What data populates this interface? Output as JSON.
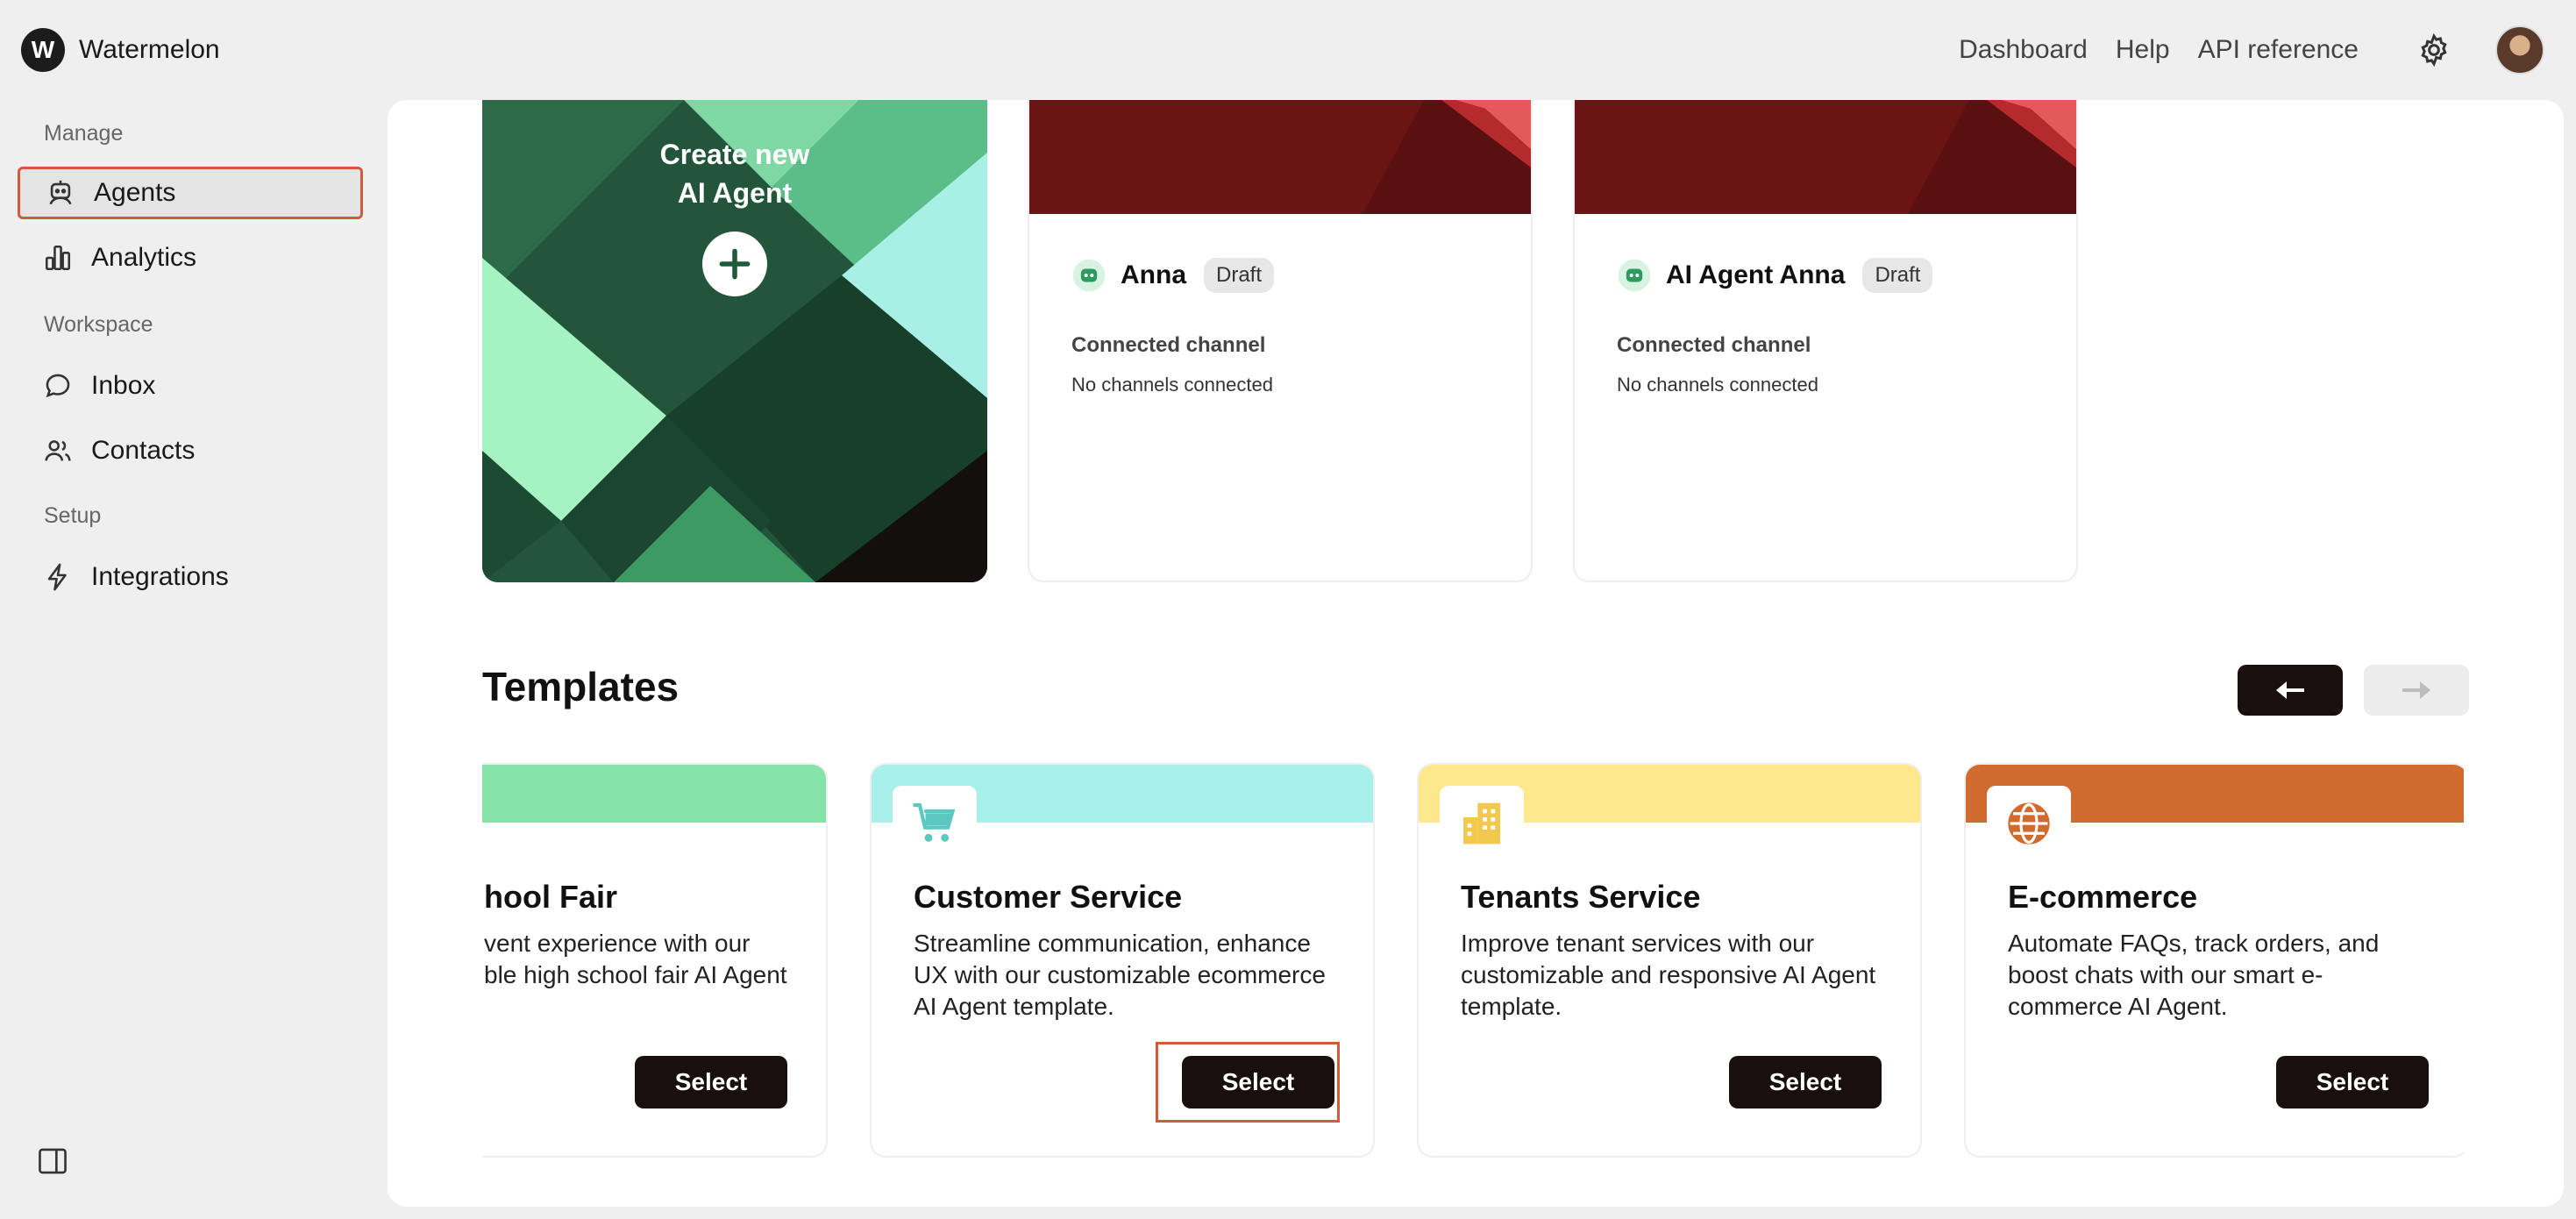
{
  "app": {
    "name": "Watermelon",
    "logo_letter": "W"
  },
  "topnav": {
    "links": [
      "Dashboard",
      "Help",
      "API reference"
    ],
    "settings_icon": "gear-icon",
    "avatar_icon": "user-avatar"
  },
  "sidebar": {
    "sections": [
      {
        "label": "Manage",
        "items": [
          {
            "label": "Agents",
            "icon": "robot-icon",
            "active": true
          },
          {
            "label": "Analytics",
            "icon": "bar-chart-icon",
            "active": false
          }
        ]
      },
      {
        "label": "Workspace",
        "items": [
          {
            "label": "Inbox",
            "icon": "chat-bubble-icon",
            "active": false
          },
          {
            "label": "Contacts",
            "icon": "users-icon",
            "active": false
          }
        ]
      },
      {
        "label": "Setup",
        "items": [
          {
            "label": "Integrations",
            "icon": "lightning-icon",
            "active": false
          }
        ]
      }
    ],
    "toggle_icon": "sidebar-toggle-icon"
  },
  "agents": {
    "create_card": {
      "line1": "Create new",
      "line2": "AI Agent"
    },
    "cards": [
      {
        "name": "Anna",
        "status": "Draft",
        "channel_label": "Connected channel",
        "channel_value": "No channels connected"
      },
      {
        "name": "AI Agent Anna",
        "status": "Draft",
        "channel_label": "Connected channel",
        "channel_value": "No channels connected"
      }
    ]
  },
  "templates": {
    "title": "Templates",
    "prev_icon": "arrow-left-icon",
    "next_icon": "arrow-right-icon",
    "items": [
      {
        "title": "School Fair",
        "title_visible": "hool Fair",
        "desc_line1": "vent experience with our",
        "desc_line2": "ble high school fair AI Agent",
        "select": "Select",
        "color": "#86e3a8"
      },
      {
        "title": "Customer Service",
        "desc": "Streamline communication, enhance UX with our customizable ecommerce AI Agent template.",
        "select": "Select",
        "color": "#a7f1ea",
        "icon": "shopping-cart-icon"
      },
      {
        "title": "Tenants Service",
        "desc": "Improve tenant services with our customizable and responsive AI Agent template.",
        "select": "Select",
        "color": "#fde98c",
        "icon": "building-icon"
      },
      {
        "title": "E-commerce",
        "desc": "Automate FAQs, track orders, and boost chats with our smart e-commerce AI Agent.",
        "select": "Select",
        "color": "#d06a2e",
        "icon": "globe-icon"
      }
    ]
  },
  "colors": {
    "accent_outline": "#d05a3e",
    "dark": "#1a0f0f",
    "agent_banner": "#6b1414"
  }
}
